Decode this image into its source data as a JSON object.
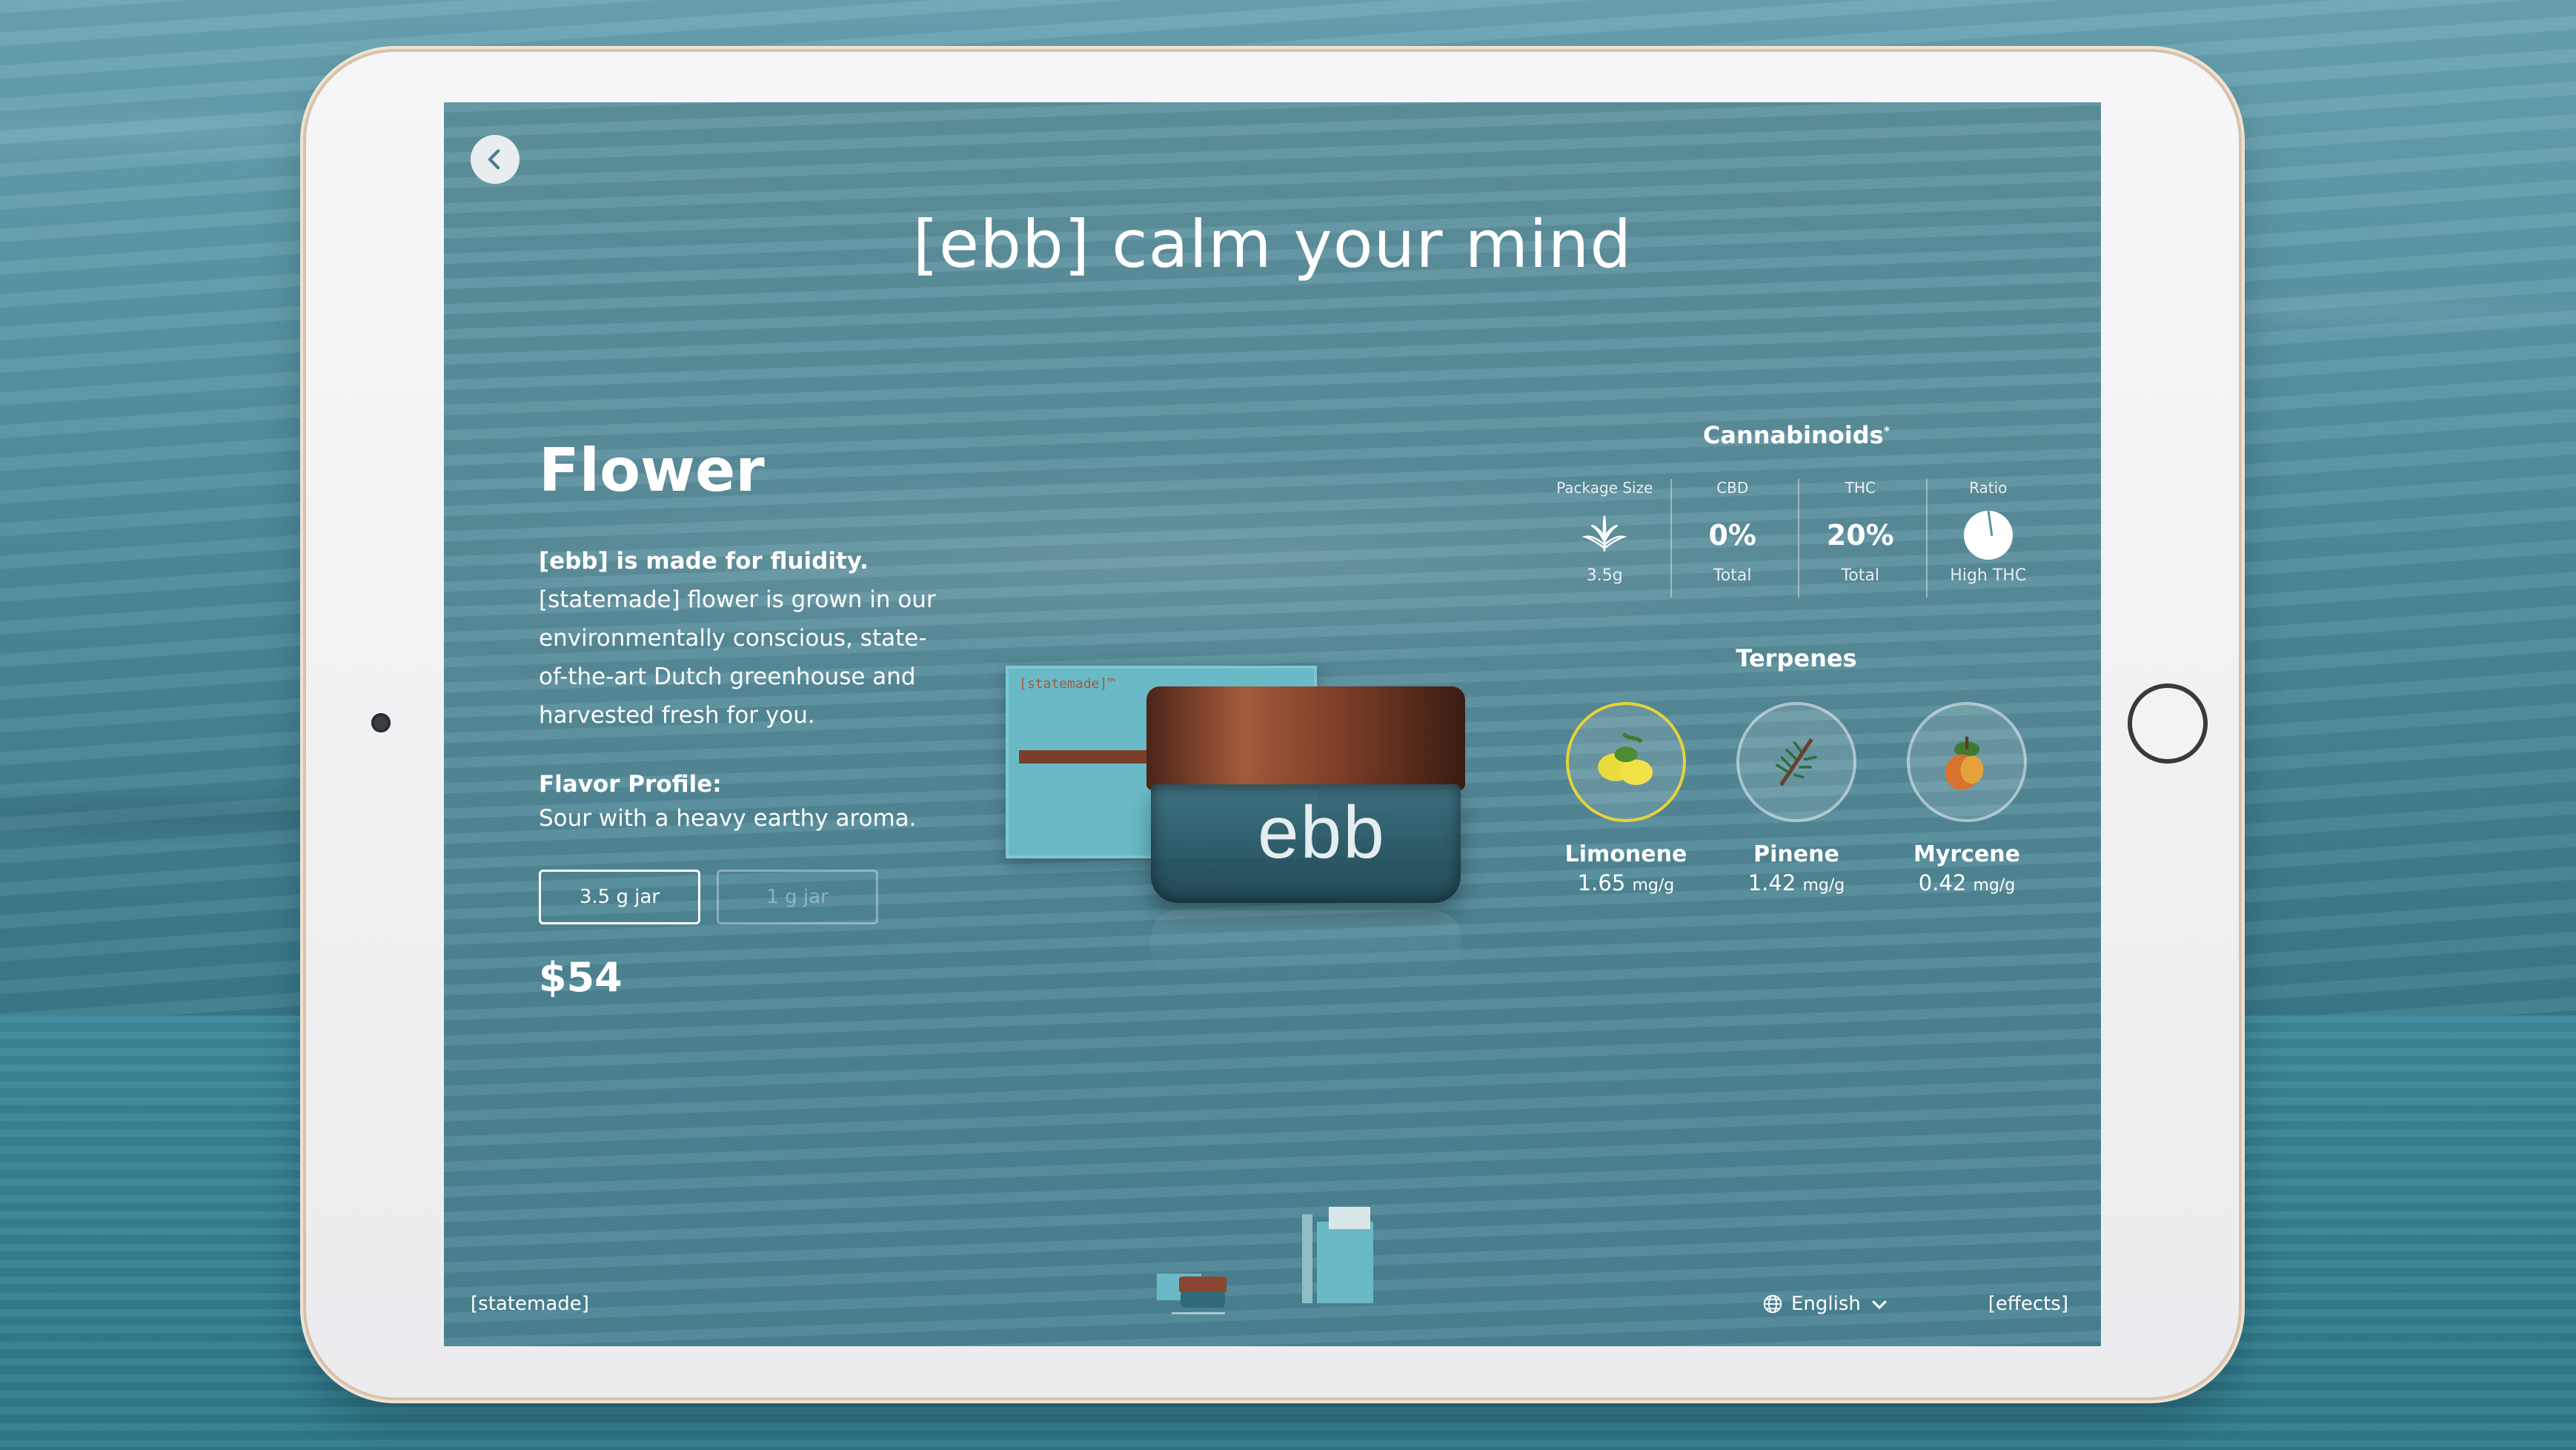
{
  "page": {
    "title": "[ebb] calm your mind",
    "brand_footer": "[statemade]",
    "language": "English",
    "effects_link": "[effects]"
  },
  "product": {
    "category": "Flower",
    "desc_bold": "[ebb] is made for fluidity.",
    "desc": "[statemade] flower is grown in our environmentally conscious, state-of-the-art Dutch greenhouse and harvested fresh for you.",
    "flavor_heading": "Flavor Profile:",
    "flavor": "Sour with a heavy earthy aroma.",
    "sizes": [
      {
        "label": "3.5 g jar",
        "selected": true
      },
      {
        "label": "1 g jar",
        "selected": false
      }
    ],
    "price": "$54",
    "jar_text": "ebb",
    "box_label": "[statemade]™"
  },
  "cannabinoids": {
    "heading": "Cannabinoids",
    "note": "*",
    "stats": [
      {
        "label": "Package Size",
        "value_icon": "cannabis-leaf-icon",
        "sub": "3.5g"
      },
      {
        "label": "CBD",
        "value": "0%",
        "sub": "Total"
      },
      {
        "label": "THC",
        "value": "20%",
        "sub": "Total"
      },
      {
        "label": "Ratio",
        "value_icon": "pie-ratio-icon",
        "sub": "High THC"
      }
    ]
  },
  "terpenes": {
    "heading": "Terpenes",
    "items": [
      {
        "name": "Limonene",
        "value": "1.65",
        "unit": "mg/g",
        "icon": "lemon-icon"
      },
      {
        "name": "Pinene",
        "value": "1.42",
        "unit": "mg/g",
        "icon": "pine-icon"
      },
      {
        "name": "Myrcene",
        "value": "0.42",
        "unit": "mg/g",
        "icon": "mango-icon"
      }
    ]
  },
  "colors": {
    "screen_bg": "#5a8e9c",
    "accent_ring": "#e6d33a",
    "lid": "#8a4630",
    "box": "#6ab9c7"
  }
}
